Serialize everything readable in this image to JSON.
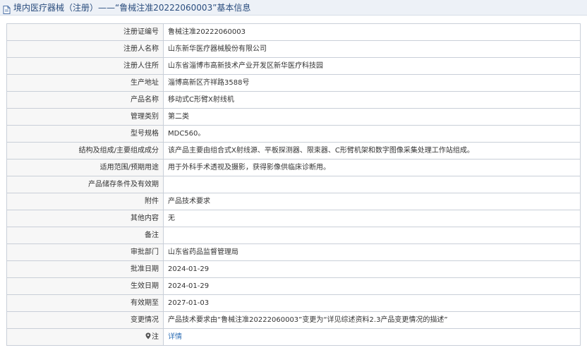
{
  "header": {
    "title": "境内医疗器械（注册）——“鲁械注准20222060003”基本信息"
  },
  "rows": [
    {
      "label": "注册证编号",
      "value": "鲁械注准20222060003"
    },
    {
      "label": "注册人名称",
      "value": "山东新华医疗器械股份有限公司"
    },
    {
      "label": "注册人住所",
      "value": "山东省淄博市高新技术产业开发区新华医疗科技园"
    },
    {
      "label": "生产地址",
      "value": "淄博高新区齐祥路3588号"
    },
    {
      "label": "产品名称",
      "value": "移动式C形臂X射线机"
    },
    {
      "label": "管理类别",
      "value": "第二类"
    },
    {
      "label": "型号规格",
      "value": "MDC560。"
    },
    {
      "label": "结构及组成/主要组成成分",
      "value": "该产品主要由组合式X射线源、平板探测器、限束器、C形臂机架和数字图像采集处理工作站组成。"
    },
    {
      "label": "适用范围/预期用途",
      "value": "用于外科手术透视及摄影，获得影像供临床诊断用。"
    },
    {
      "label": "产品储存条件及有效期",
      "value": ""
    },
    {
      "label": "附件",
      "value": "产品技术要求"
    },
    {
      "label": "其他内容",
      "value": "无"
    },
    {
      "label": "备注",
      "value": ""
    },
    {
      "label": "审批部门",
      "value": "山东省药品监督管理局"
    },
    {
      "label": "批准日期",
      "value": "2024-01-29"
    },
    {
      "label": "生效日期",
      "value": "2024-01-29"
    },
    {
      "label": "有效期至",
      "value": "2027-01-03"
    },
    {
      "label": "变更情况",
      "value": "产品技术要求由“鲁械注准20222060003”变更为“详见综述资料2.3产品变更情况的描述”"
    }
  ],
  "footer_row": {
    "label": "注",
    "icon": "map-pin-icon",
    "link_text": "详情"
  }
}
